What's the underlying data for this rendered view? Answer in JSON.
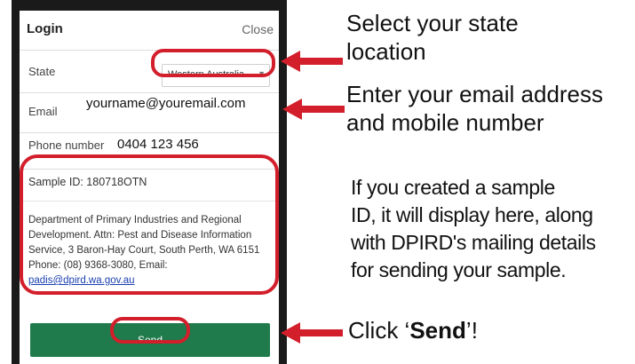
{
  "dialog": {
    "title": "Login",
    "close_label": "Close",
    "state_label": "State",
    "state_value": "Western Australia",
    "email_label": "Email",
    "email_value": "yourname@youremail.com",
    "phone_label": "Phone number",
    "phone_value": "0404 123 456",
    "sample_id": "Sample ID: 180718OTN",
    "address_text": "Department of Primary Industries and Regional Development. Attn: Pest and Disease Information Service, 3 Baron-Hay Court, South Perth, WA 6151 Phone: (08) 9368-3080, Email: ",
    "address_email": "padis@dpird.wa.gov.au",
    "send_label": "Send"
  },
  "callouts": {
    "state_line1": "Select your state",
    "state_line2": "location",
    "contact_line1": "Enter your email address",
    "contact_line2": "and mobile number",
    "sample_lines": [
      "If you created a sample",
      "ID, it will display here, along",
      "with DPIRD's mailing details",
      "for sending your sample."
    ],
    "send_prefix": "Click ‘",
    "send_bold": "Send",
    "send_suffix": "’!"
  },
  "colors": {
    "highlight": "#d21f2b",
    "send_button": "#1f7a4c"
  }
}
